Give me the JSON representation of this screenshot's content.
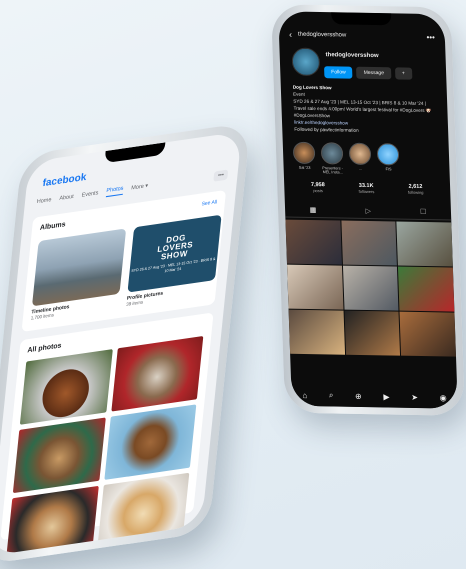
{
  "instagram": {
    "username": "thedogloversshow",
    "back_icon": "‹",
    "more_icon": "•••",
    "follow_label": "Follow",
    "message_label": "Message",
    "add_user_icon": "+",
    "bio_name": "Dog Lovers Show",
    "bio_category": "Event",
    "bio_text": "SYD 26 & 27 Aug '23 | MEL 13-15 Oct '23 | BRIS 8 & 10 Mar '24 | Travel sale ends 4:00pm! World's largest festival for #DogLovers 🐶 #DogLoversShow",
    "bio_link": "linktr.ee/thedogloversshow",
    "followed_by": "Followed by pawfectinformation",
    "highlights": [
      "Sat '23",
      "Presenters - MEL Insta...",
      "...",
      "FIS"
    ],
    "stats": [
      {
        "value": "7,958",
        "label": "posts"
      },
      {
        "value": "33.1K",
        "label": "followers"
      },
      {
        "value": "2,612",
        "label": "following"
      }
    ],
    "nav_icons": [
      "⌂",
      "⌕",
      "⊕",
      "▶",
      "➤",
      "◉"
    ]
  },
  "facebook": {
    "logo": "facebook",
    "tabs": [
      "Home",
      "About",
      "Events",
      "Photos",
      "More ▾"
    ],
    "menu_icon": "•••",
    "albums_title": "Albums",
    "see_all": "See All",
    "albums": [
      {
        "title": "Timeline photos",
        "count": "1,700 items"
      },
      {
        "title": "Profile pictures",
        "count": "39 items"
      }
    ],
    "dog_lovers_show_logo": [
      "DOG",
      "LOVERS",
      "SHOW"
    ],
    "logo_dates": "SYD 26 & 27 Aug '23 · MEL 13-15 Oct '23 · BRIS 8 & 10 Mar '24",
    "all_photos_title": "All photos"
  },
  "colors": {
    "fb_blue": "#1877f2",
    "ig_blue": "#0095f6",
    "ig_bg": "#0c0c0c"
  }
}
